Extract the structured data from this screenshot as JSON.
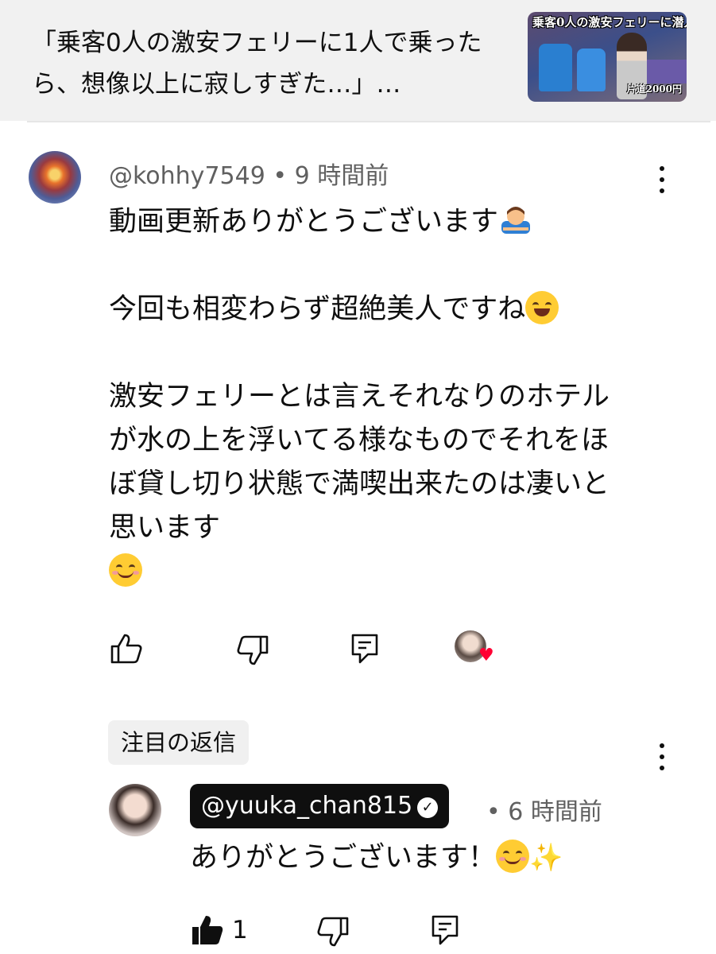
{
  "video": {
    "title": "「乗客0人の激安フェリーに1人で乗ったら、想像以上に寂しすぎた…」…",
    "thumbnail_title": "乗客0人の激安フェリーに潜入",
    "thumbnail_price": "片道2000円"
  },
  "comment": {
    "author": "@kohhy7549",
    "separator": "•",
    "time": "9 時間前",
    "text_1": "動画更新ありがとうございます",
    "text_2": "今回も相変わらず超絶美人ですね",
    "text_3": "激安フェリーとは言えそれなりのホテルが水の上を浮いてる様なものでそれをほぼ貸し切り状態で満喫出来たのは凄いと思います",
    "emoji_1": "🙇‍♂️",
    "icons": {
      "more": "more-vert-icon",
      "like": "thumb-up-outline-icon",
      "dislike": "thumb-down-outline-icon",
      "reply": "reply-icon",
      "creator_heart": "creator-heart-icon"
    }
  },
  "pinned_reply": {
    "chip_label": "注目の返信",
    "author": "@yuuka_chan815",
    "verified_icon": "verified-check-icon",
    "separator": "•",
    "time": "6 時間前",
    "text": "ありがとうございます！",
    "like_count": "1",
    "icons": {
      "more": "more-vert-icon",
      "like": "thumb-up-filled-icon",
      "dislike": "thumb-down-outline-icon",
      "reply": "reply-icon"
    }
  },
  "colors": {
    "header_bg": "#f1f1f1",
    "text_primary": "#0f0f0f",
    "text_secondary": "#606060",
    "creator_chip_bg": "#0f0f0f",
    "heart": "#ff0033"
  }
}
